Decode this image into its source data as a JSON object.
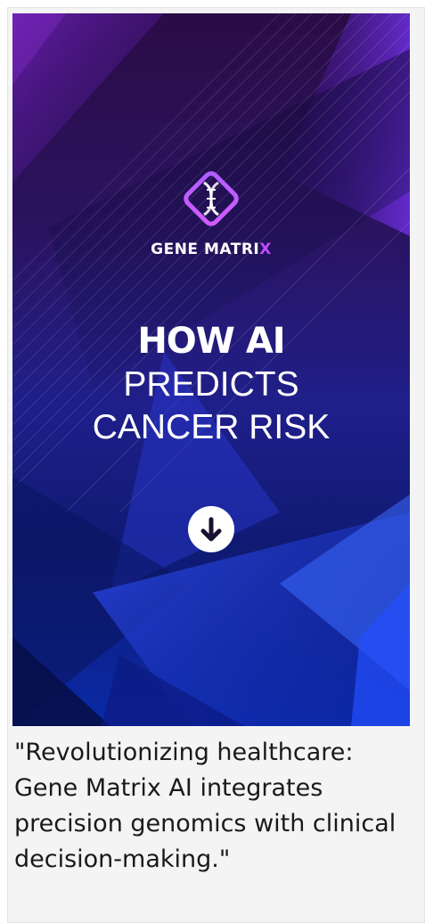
{
  "banner": {
    "brand_name": "GENE MATRIX",
    "headline_line1": "HOW AI",
    "headline_line2": "PREDICTS",
    "headline_line3": "CANCER RISK",
    "logo_icon": "dna-diamond-icon",
    "scroll_icon": "arrow-down-circle-icon",
    "colors": {
      "accent": "#c24cff",
      "background_top": "#2a0c46",
      "background_bottom": "#0a2aa8"
    }
  },
  "caption": {
    "text": "\"Revolutionizing healthcare: Gene Matrix AI integrates precision genomics with clinical decision-making.\""
  }
}
